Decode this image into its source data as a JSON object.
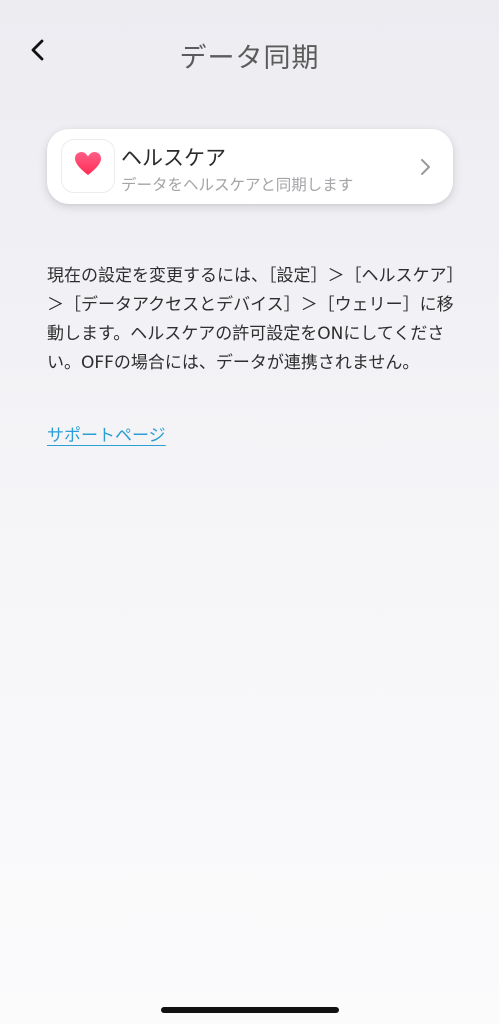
{
  "header": {
    "title": "データ同期",
    "back_icon": "chevron-left-icon"
  },
  "health_card": {
    "title": "ヘルスケア",
    "subtitle": "データをヘルスケアと同期します",
    "icon": "heart-icon",
    "icon_color": "#ff2d55",
    "chevron_icon": "chevron-right-icon"
  },
  "description": "現在の設定を変更するには、［設定］＞［ヘルスケア］＞［データアクセスとデバイス］＞［ウェリー］に移動します。ヘルスケアの許可設定をONにしてください。OFFの場合には、データが連携されません。",
  "support_link": {
    "label": "サポートページ",
    "color": "#2b9ed6"
  }
}
